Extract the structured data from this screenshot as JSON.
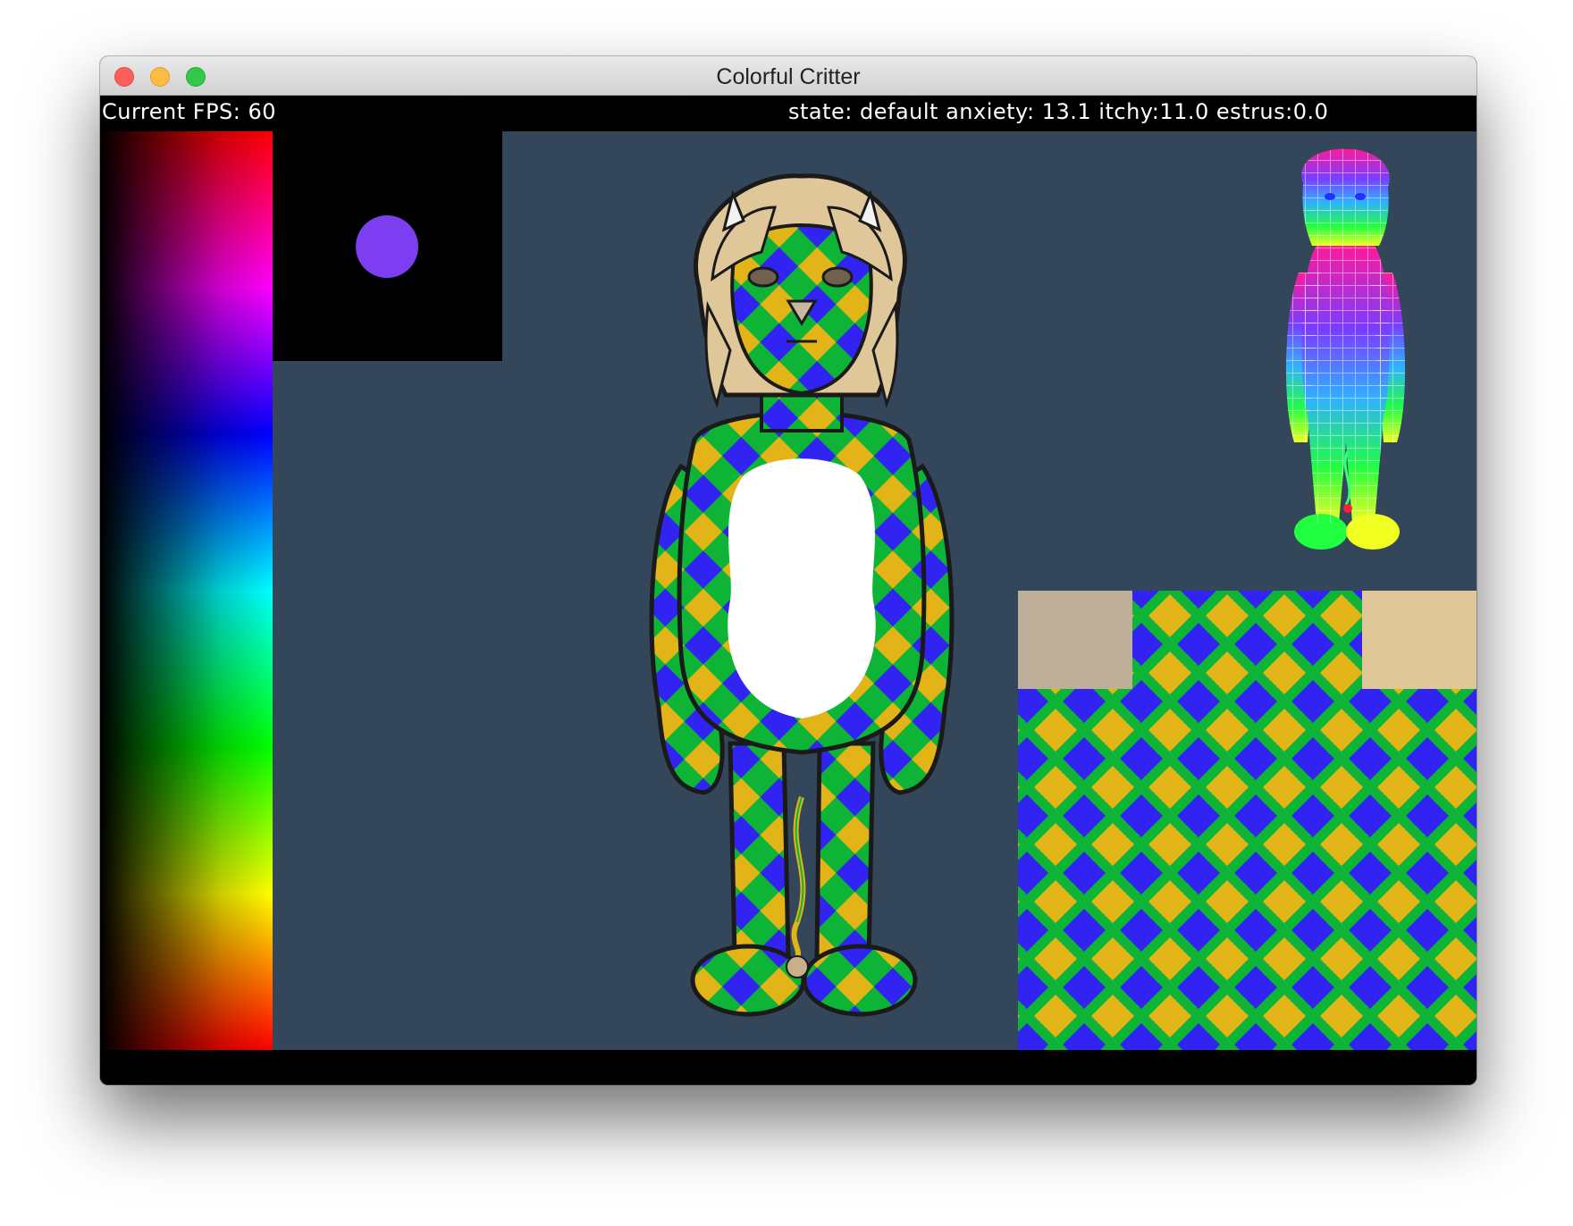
{
  "window": {
    "title": "Colorful Critter"
  },
  "hud": {
    "fps_text": "Current FPS: 60",
    "state_text": "state: default anxiety: 13.1 itchy:11.0 estrus:0.0"
  },
  "palette": {
    "selected_color": "#7d3df0",
    "viewport_background": "#34465a"
  },
  "critter": {
    "pattern_colors": {
      "green": "#0eb435",
      "blue": "#3124f2",
      "gold": "#e2b418",
      "belly": "#ffffff",
      "hair": "#dfc79a",
      "outline": "#1a1a1a"
    }
  },
  "icons": {
    "close": "close-icon",
    "minimize": "minimize-icon",
    "maximize": "maximize-icon"
  }
}
